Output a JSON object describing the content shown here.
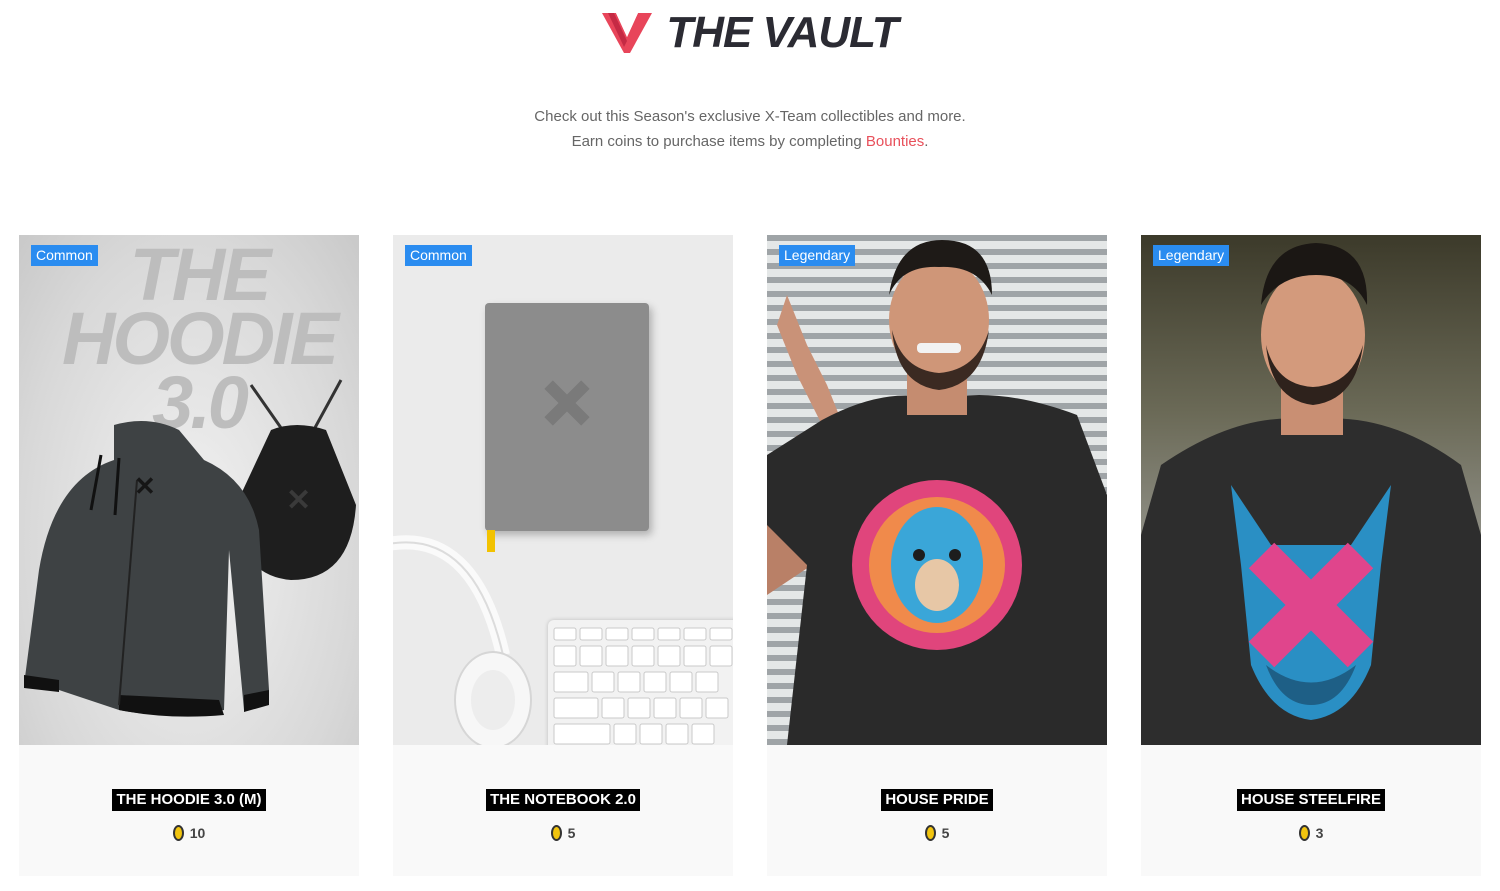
{
  "header": {
    "title": "THE VAULT",
    "colors": {
      "logo_red": "#e8455a",
      "title": "#2b2b33"
    }
  },
  "intro": {
    "line1": "Check out this Season's exclusive X-Team collectibles and more.",
    "line2_prefix": "Earn coins to purchase items by completing ",
    "line2_link": "Bounties",
    "line2_suffix": ".",
    "link_color": "#e8505b"
  },
  "products": [
    {
      "rarity": "Common",
      "name": "THE HOODIE 3.0 (M)",
      "price": "10",
      "image_icon": "hoodie-image",
      "image_text": "THE HOODIE 3.0"
    },
    {
      "rarity": "Common",
      "name": "THE NOTEBOOK 2.0",
      "price": "5",
      "image_icon": "notebook-image"
    },
    {
      "rarity": "Legendary",
      "name": "HOUSE PRIDE",
      "price": "5",
      "image_icon": "lion-tshirt-image"
    },
    {
      "rarity": "Legendary",
      "name": "HOUSE STEELFIRE",
      "price": "3",
      "image_icon": "dragon-tshirt-image"
    }
  ],
  "colors": {
    "badge": "#2a8cf0",
    "coin": "#f1c40f",
    "card_bg": "#f9f9f9"
  }
}
